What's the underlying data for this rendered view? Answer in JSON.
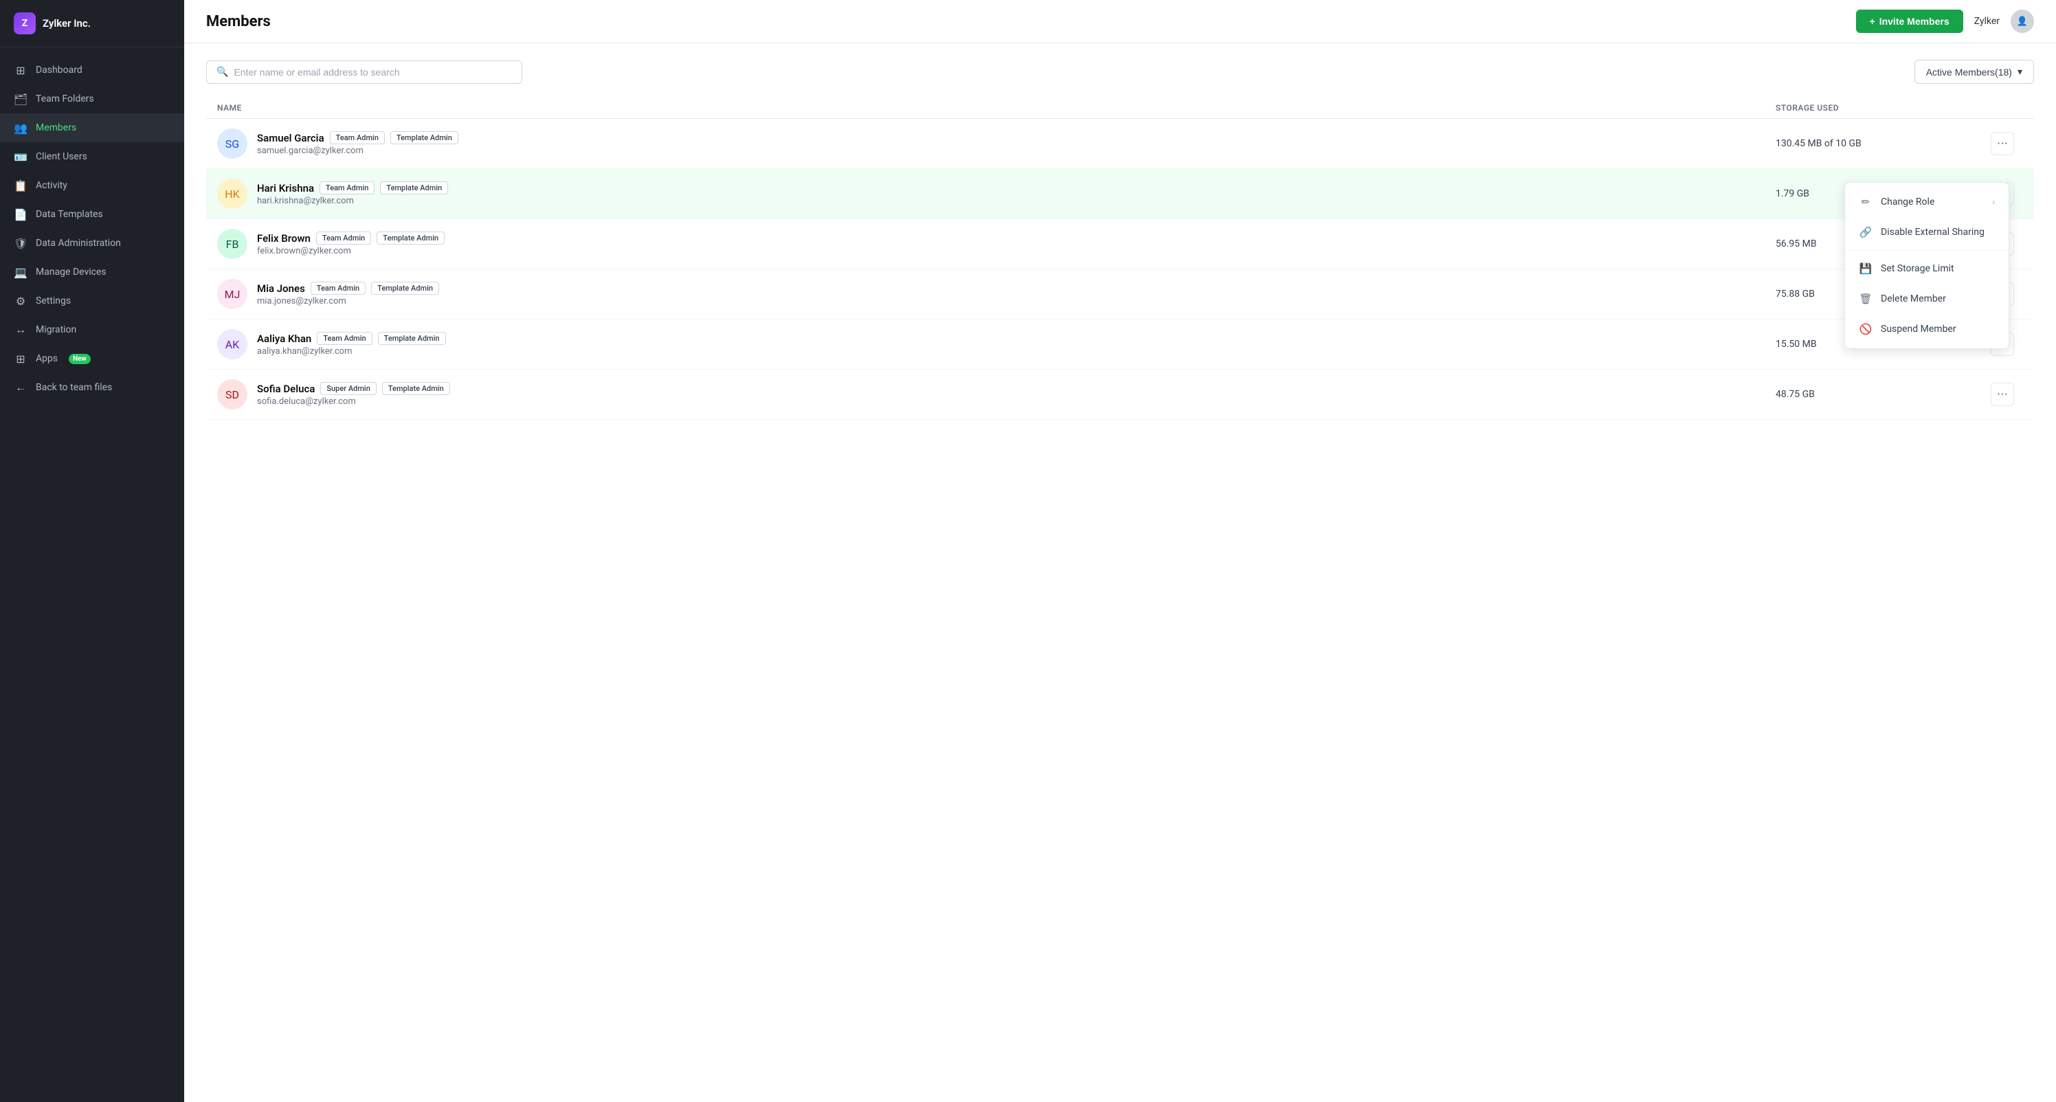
{
  "app": {
    "logo_letter": "Z",
    "company_name": "Zylker Inc."
  },
  "sidebar": {
    "items": [
      {
        "id": "dashboard",
        "label": "Dashboard",
        "icon": "⊞",
        "active": false
      },
      {
        "id": "team-folders",
        "label": "Team Folders",
        "icon": "🗂",
        "active": false
      },
      {
        "id": "members",
        "label": "Members",
        "icon": "👥",
        "active": true
      },
      {
        "id": "client-users",
        "label": "Client Users",
        "icon": "🪪",
        "active": false
      },
      {
        "id": "activity",
        "label": "Activity",
        "icon": "📋",
        "active": false
      },
      {
        "id": "data-templates",
        "label": "Data Templates",
        "icon": "📄",
        "active": false
      },
      {
        "id": "data-administration",
        "label": "Data Administration",
        "icon": "🛡",
        "active": false
      },
      {
        "id": "manage-devices",
        "label": "Manage Devices",
        "icon": "💻",
        "active": false
      },
      {
        "id": "settings",
        "label": "Settings",
        "icon": "⚙",
        "active": false
      },
      {
        "id": "migration",
        "label": "Migration",
        "icon": "↔",
        "active": false
      },
      {
        "id": "apps",
        "label": "Apps",
        "icon": "⊞",
        "active": false,
        "badge": "New"
      },
      {
        "id": "back-to-team",
        "label": "Back to team files",
        "icon": "←",
        "active": false
      }
    ]
  },
  "header": {
    "title": "Members",
    "invite_button": "+ Invite Members",
    "user_name": "Zylker"
  },
  "toolbar": {
    "search_placeholder": "Enter name or email address to search",
    "filter_label": "Active Members(18)",
    "filter_icon": "▾"
  },
  "table": {
    "columns": [
      "NAME",
      "STORAGE USED",
      ""
    ],
    "members": [
      {
        "id": 1,
        "name": "Samuel Garcia",
        "email": "samuel.garcia@zylker.com",
        "badges": [
          "Team Admin",
          "Template Admin"
        ],
        "storage": "130.45 MB of 10 GB",
        "avatar_initials": "SG",
        "avatar_class": "avatar-blue"
      },
      {
        "id": 2,
        "name": "Hari Krishna",
        "email": "hari.krishna@zylker.com",
        "badges": [
          "Team Admin",
          "Template Admin"
        ],
        "storage": "1.79 GB",
        "avatar_initials": "HK",
        "avatar_class": "avatar-amber",
        "menu_open": true
      },
      {
        "id": 3,
        "name": "Felix Brown",
        "email": "felix.brown@zylker.com",
        "badges": [
          "Team Admin",
          "Template Admin"
        ],
        "storage": "56.95 MB",
        "avatar_initials": "FB",
        "avatar_class": "avatar-green"
      },
      {
        "id": 4,
        "name": "Mia Jones",
        "email": "mia.jones@zylker.com",
        "badges": [
          "Team Admin",
          "Template Admin"
        ],
        "storage": "75.88 GB",
        "avatar_initials": "MJ",
        "avatar_class": "avatar-pink"
      },
      {
        "id": 5,
        "name": "Aaliya Khan",
        "email": "aaliya.khan@zylker.com",
        "badges": [
          "Team Admin",
          "Template Admin"
        ],
        "storage": "15.50 MB",
        "avatar_initials": "AK",
        "avatar_class": "avatar-purple"
      },
      {
        "id": 6,
        "name": "Sofia Deluca",
        "email": "sofia.deluca@zylker.com",
        "badges": [
          "Super Admin",
          "Template Admin"
        ],
        "storage": "48.75 GB",
        "avatar_initials": "SD",
        "avatar_class": "avatar-red"
      }
    ]
  },
  "context_menu": {
    "items": [
      {
        "id": "change-role",
        "label": "Change Role",
        "icon": "✏",
        "has_submenu": true
      },
      {
        "id": "disable-external-sharing",
        "label": "Disable External Sharing",
        "icon": "🔗",
        "has_submenu": false
      },
      {
        "id": "set-storage-limit",
        "label": "Set Storage Limit",
        "icon": "💾",
        "has_submenu": false
      },
      {
        "id": "delete-member",
        "label": "Delete Member",
        "icon": "🗑",
        "has_submenu": false
      },
      {
        "id": "suspend-member",
        "label": "Suspend Member",
        "icon": "🚫",
        "has_submenu": false
      }
    ]
  }
}
